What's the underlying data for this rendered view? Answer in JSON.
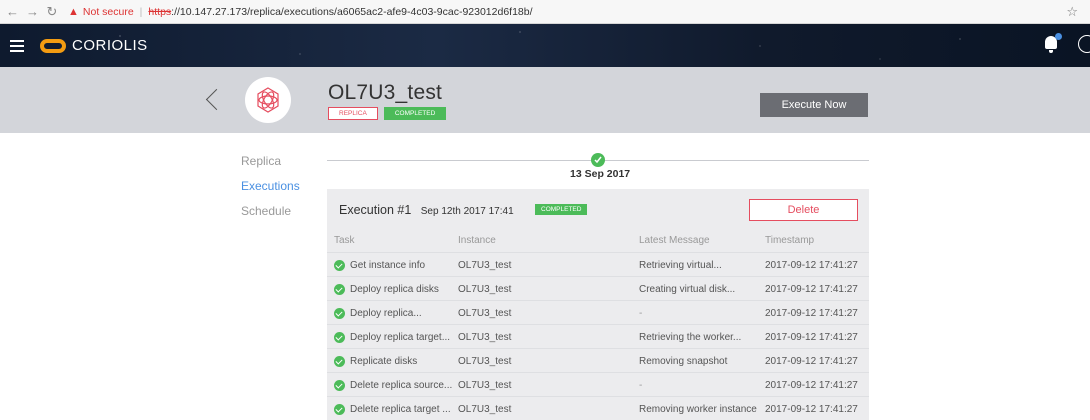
{
  "browser": {
    "not_secure": "Not secure",
    "url_scheme": "https",
    "url_rest": "://10.147.27.173/replica/executions/a6065ac2-afe9-4c03-9cac-923012d6f18b/"
  },
  "app": {
    "brand": "CORIOLIS"
  },
  "replica": {
    "title": "OL7U3_test",
    "type_badge": "REPLICA",
    "status_badge": "COMPLETED",
    "execute_label": "Execute Now"
  },
  "sidenav": {
    "items": [
      {
        "label": "Replica"
      },
      {
        "label": "Executions"
      },
      {
        "label": "Schedule"
      }
    ]
  },
  "timeline": {
    "date": "13 Sep 2017"
  },
  "execution": {
    "title": "Execution #1",
    "date": "Sep 12th 2017 17:41",
    "status": "COMPLETED",
    "delete_label": "Delete",
    "columns": [
      "Task",
      "Instance",
      "Latest Message",
      "Timestamp"
    ],
    "tasks": [
      {
        "task": "Get instance info",
        "instance": "OL7U3_test",
        "message": "Retrieving virtual...",
        "timestamp": "2017-09-12 17:41:27"
      },
      {
        "task": "Deploy replica disks",
        "instance": "OL7U3_test",
        "message": "Creating virtual disk...",
        "timestamp": "2017-09-12 17:41:27"
      },
      {
        "task": "Deploy replica...",
        "instance": "OL7U3_test",
        "message": "-",
        "timestamp": "2017-09-12 17:41:27"
      },
      {
        "task": "Deploy replica target...",
        "instance": "OL7U3_test",
        "message": "Retrieving the worker...",
        "timestamp": "2017-09-12 17:41:27"
      },
      {
        "task": "Replicate disks",
        "instance": "OL7U3_test",
        "message": "Removing snapshot",
        "timestamp": "2017-09-12 17:41:27"
      },
      {
        "task": "Delete replica source...",
        "instance": "OL7U3_test",
        "message": "-",
        "timestamp": "2017-09-12 17:41:27"
      },
      {
        "task": "Delete replica target ...",
        "instance": "OL7U3_test",
        "message": "Removing worker instance",
        "timestamp": "2017-09-12 17:41:27"
      }
    ]
  }
}
